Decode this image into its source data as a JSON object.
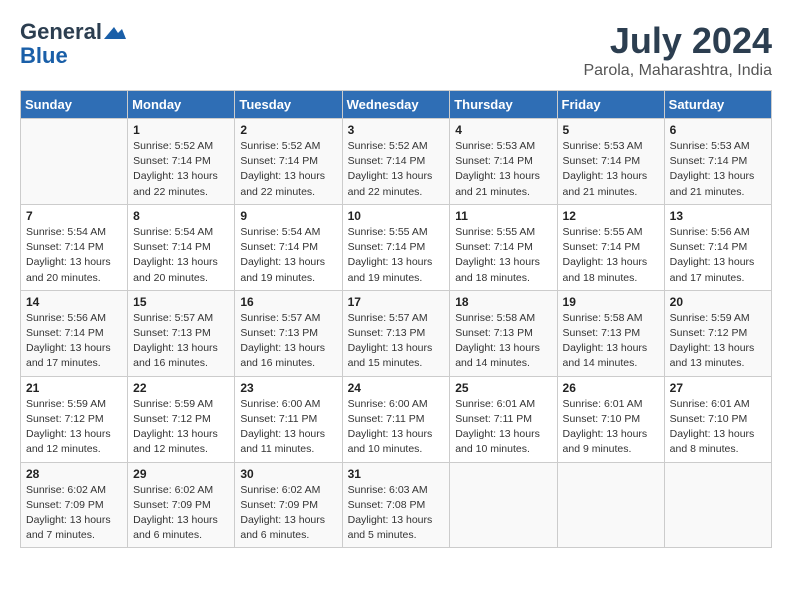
{
  "header": {
    "logo_line1": "General",
    "logo_line2": "Blue",
    "month": "July 2024",
    "location": "Parola, Maharashtra, India"
  },
  "weekdays": [
    "Sunday",
    "Monday",
    "Tuesday",
    "Wednesday",
    "Thursday",
    "Friday",
    "Saturday"
  ],
  "weeks": [
    [
      {
        "day": "",
        "sunrise": "",
        "sunset": "",
        "daylight": ""
      },
      {
        "day": "1",
        "sunrise": "Sunrise: 5:52 AM",
        "sunset": "Sunset: 7:14 PM",
        "daylight": "Daylight: 13 hours and 22 minutes."
      },
      {
        "day": "2",
        "sunrise": "Sunrise: 5:52 AM",
        "sunset": "Sunset: 7:14 PM",
        "daylight": "Daylight: 13 hours and 22 minutes."
      },
      {
        "day": "3",
        "sunrise": "Sunrise: 5:52 AM",
        "sunset": "Sunset: 7:14 PM",
        "daylight": "Daylight: 13 hours and 22 minutes."
      },
      {
        "day": "4",
        "sunrise": "Sunrise: 5:53 AM",
        "sunset": "Sunset: 7:14 PM",
        "daylight": "Daylight: 13 hours and 21 minutes."
      },
      {
        "day": "5",
        "sunrise": "Sunrise: 5:53 AM",
        "sunset": "Sunset: 7:14 PM",
        "daylight": "Daylight: 13 hours and 21 minutes."
      },
      {
        "day": "6",
        "sunrise": "Sunrise: 5:53 AM",
        "sunset": "Sunset: 7:14 PM",
        "daylight": "Daylight: 13 hours and 21 minutes."
      }
    ],
    [
      {
        "day": "7",
        "sunrise": "Sunrise: 5:54 AM",
        "sunset": "Sunset: 7:14 PM",
        "daylight": "Daylight: 13 hours and 20 minutes."
      },
      {
        "day": "8",
        "sunrise": "Sunrise: 5:54 AM",
        "sunset": "Sunset: 7:14 PM",
        "daylight": "Daylight: 13 hours and 20 minutes."
      },
      {
        "day": "9",
        "sunrise": "Sunrise: 5:54 AM",
        "sunset": "Sunset: 7:14 PM",
        "daylight": "Daylight: 13 hours and 19 minutes."
      },
      {
        "day": "10",
        "sunrise": "Sunrise: 5:55 AM",
        "sunset": "Sunset: 7:14 PM",
        "daylight": "Daylight: 13 hours and 19 minutes."
      },
      {
        "day": "11",
        "sunrise": "Sunrise: 5:55 AM",
        "sunset": "Sunset: 7:14 PM",
        "daylight": "Daylight: 13 hours and 18 minutes."
      },
      {
        "day": "12",
        "sunrise": "Sunrise: 5:55 AM",
        "sunset": "Sunset: 7:14 PM",
        "daylight": "Daylight: 13 hours and 18 minutes."
      },
      {
        "day": "13",
        "sunrise": "Sunrise: 5:56 AM",
        "sunset": "Sunset: 7:14 PM",
        "daylight": "Daylight: 13 hours and 17 minutes."
      }
    ],
    [
      {
        "day": "14",
        "sunrise": "Sunrise: 5:56 AM",
        "sunset": "Sunset: 7:14 PM",
        "daylight": "Daylight: 13 hours and 17 minutes."
      },
      {
        "day": "15",
        "sunrise": "Sunrise: 5:57 AM",
        "sunset": "Sunset: 7:13 PM",
        "daylight": "Daylight: 13 hours and 16 minutes."
      },
      {
        "day": "16",
        "sunrise": "Sunrise: 5:57 AM",
        "sunset": "Sunset: 7:13 PM",
        "daylight": "Daylight: 13 hours and 16 minutes."
      },
      {
        "day": "17",
        "sunrise": "Sunrise: 5:57 AM",
        "sunset": "Sunset: 7:13 PM",
        "daylight": "Daylight: 13 hours and 15 minutes."
      },
      {
        "day": "18",
        "sunrise": "Sunrise: 5:58 AM",
        "sunset": "Sunset: 7:13 PM",
        "daylight": "Daylight: 13 hours and 14 minutes."
      },
      {
        "day": "19",
        "sunrise": "Sunrise: 5:58 AM",
        "sunset": "Sunset: 7:13 PM",
        "daylight": "Daylight: 13 hours and 14 minutes."
      },
      {
        "day": "20",
        "sunrise": "Sunrise: 5:59 AM",
        "sunset": "Sunset: 7:12 PM",
        "daylight": "Daylight: 13 hours and 13 minutes."
      }
    ],
    [
      {
        "day": "21",
        "sunrise": "Sunrise: 5:59 AM",
        "sunset": "Sunset: 7:12 PM",
        "daylight": "Daylight: 13 hours and 12 minutes."
      },
      {
        "day": "22",
        "sunrise": "Sunrise: 5:59 AM",
        "sunset": "Sunset: 7:12 PM",
        "daylight": "Daylight: 13 hours and 12 minutes."
      },
      {
        "day": "23",
        "sunrise": "Sunrise: 6:00 AM",
        "sunset": "Sunset: 7:11 PM",
        "daylight": "Daylight: 13 hours and 11 minutes."
      },
      {
        "day": "24",
        "sunrise": "Sunrise: 6:00 AM",
        "sunset": "Sunset: 7:11 PM",
        "daylight": "Daylight: 13 hours and 10 minutes."
      },
      {
        "day": "25",
        "sunrise": "Sunrise: 6:01 AM",
        "sunset": "Sunset: 7:11 PM",
        "daylight": "Daylight: 13 hours and 10 minutes."
      },
      {
        "day": "26",
        "sunrise": "Sunrise: 6:01 AM",
        "sunset": "Sunset: 7:10 PM",
        "daylight": "Daylight: 13 hours and 9 minutes."
      },
      {
        "day": "27",
        "sunrise": "Sunrise: 6:01 AM",
        "sunset": "Sunset: 7:10 PM",
        "daylight": "Daylight: 13 hours and 8 minutes."
      }
    ],
    [
      {
        "day": "28",
        "sunrise": "Sunrise: 6:02 AM",
        "sunset": "Sunset: 7:09 PM",
        "daylight": "Daylight: 13 hours and 7 minutes."
      },
      {
        "day": "29",
        "sunrise": "Sunrise: 6:02 AM",
        "sunset": "Sunset: 7:09 PM",
        "daylight": "Daylight: 13 hours and 6 minutes."
      },
      {
        "day": "30",
        "sunrise": "Sunrise: 6:02 AM",
        "sunset": "Sunset: 7:09 PM",
        "daylight": "Daylight: 13 hours and 6 minutes."
      },
      {
        "day": "31",
        "sunrise": "Sunrise: 6:03 AM",
        "sunset": "Sunset: 7:08 PM",
        "daylight": "Daylight: 13 hours and 5 minutes."
      },
      {
        "day": "",
        "sunrise": "",
        "sunset": "",
        "daylight": ""
      },
      {
        "day": "",
        "sunrise": "",
        "sunset": "",
        "daylight": ""
      },
      {
        "day": "",
        "sunrise": "",
        "sunset": "",
        "daylight": ""
      }
    ]
  ]
}
